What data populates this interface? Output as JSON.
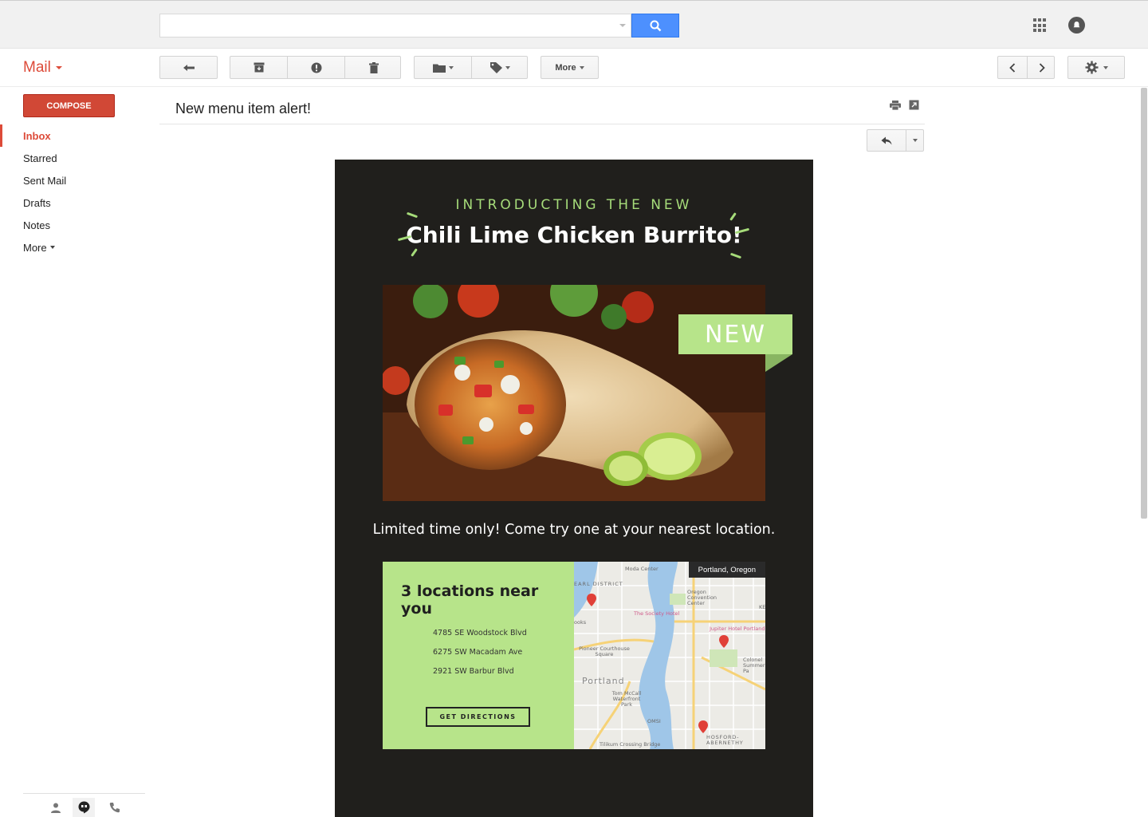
{
  "search": {
    "placeholder": ""
  },
  "app": {
    "title": "Mail"
  },
  "toolbar": {
    "more_label": "More"
  },
  "sidebar": {
    "compose_label": "COMPOSE",
    "items": [
      {
        "label": "Inbox"
      },
      {
        "label": "Starred"
      },
      {
        "label": "Sent Mail"
      },
      {
        "label": "Drafts"
      },
      {
        "label": "Notes"
      },
      {
        "label": "More"
      }
    ]
  },
  "message": {
    "subject": "New menu item alert!"
  },
  "email": {
    "intro": "INTRODUCTING THE NEW",
    "headline": "Chili Lime Chicken Burrito!",
    "badge": "NEW",
    "tagline": "Limited time only! Come try one at your nearest location.",
    "locations_title": "3 locations near you",
    "addresses": [
      "4785 SE Woodstock Blvd",
      "6275 SW Macadam Ave",
      "2921 SW Barbur Blvd"
    ],
    "directions_label": "GET DIRECTIONS",
    "map": {
      "city_label": "Portland, Oregon",
      "labels": [
        "Moda Center",
        "EARL DISTRICT",
        "Oregon Convention Center",
        "The Society Hotel",
        "Jupiter Hotel Portland",
        "Pioneer Courthouse Square",
        "Portland",
        "Colonel Summers Pa",
        "Tom McCall Waterfront Park",
        "OMSI",
        "HOSFORD-ABERNETHY",
        "Tilikum Crossing Bridge",
        "ooks",
        "KE"
      ]
    }
  },
  "colors": {
    "accent": "#dd4b39",
    "search_blue": "#4d90fe",
    "lime": "#b7e48a",
    "email_bg": "#201f1c"
  }
}
